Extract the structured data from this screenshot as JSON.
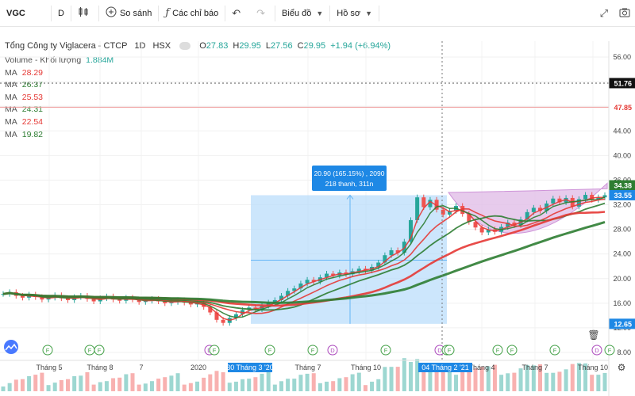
{
  "toolbar": {
    "symbol": "VGC",
    "interval": "D",
    "compare_label": "So sánh",
    "indicators_label": "Các chỉ báo",
    "chart_type_label": "Biểu đồ",
    "profile_label": "Hồ sơ"
  },
  "header": {
    "name": "Tổng Công ty Viglacera - CTCP",
    "interval": "1D",
    "exchange": "HSX",
    "o_label": "O",
    "o_value": "27.83",
    "h_label": "H",
    "h_value": "29.95",
    "l_label": "L",
    "l_value": "27.56",
    "c_label": "C",
    "c_value": "29.95",
    "change": "+1.94 (+6.94%)"
  },
  "volume": {
    "label": "Volume - Khối lượng",
    "value": "1.884M"
  },
  "ma_list": [
    {
      "label": "MA",
      "value": "28.29",
      "color": "#e53935"
    },
    {
      "label": "MA",
      "value": "26.37",
      "color": "#2e7d32"
    },
    {
      "label": "MA",
      "value": "25.53",
      "color": "#e53935"
    },
    {
      "label": "MA",
      "value": "24.31",
      "color": "#2e7d32"
    },
    {
      "label": "MA",
      "value": "22.54",
      "color": "#e53935"
    },
    {
      "label": "MA",
      "value": "19.82",
      "color": "#2e7d32"
    }
  ],
  "colors": {
    "up": "#26a69a",
    "down": "#ef5350",
    "ma_red": "#e53935",
    "ma_green": "#2e7d32",
    "measure_fill": "#bbdefb",
    "measure_label": "#1e88e5",
    "arc_fill": "#e1bee7"
  },
  "chart_data": {
    "type": "candlestick",
    "y_ticks": [
      "56.00",
      "52.00",
      "48.00",
      "44.00",
      "40.00",
      "36.00",
      "32.00",
      "28.00",
      "24.00",
      "20.00",
      "16.00",
      "12.00",
      "8.00"
    ],
    "ylim": [
      8,
      57
    ],
    "x_ticks": [
      "Tháng 5",
      "Tháng 8",
      "7",
      "2020",
      "Tháng 7",
      "Tháng 10",
      "Tháng 4",
      "Tháng 7",
      "Tháng 10"
    ],
    "x_highlight": [
      "30 Tháng 3 '20",
      "04 Tháng 2 '21"
    ],
    "price_labels": [
      {
        "value": "51.76",
        "style": "black"
      },
      {
        "value": "47.85",
        "style": "red"
      },
      {
        "value": "34.38",
        "style": "green"
      },
      {
        "value": "33.55",
        "style": "blue"
      },
      {
        "value": "12.65",
        "style": "blue"
      }
    ],
    "measure": {
      "line1": "20.90 (165.15%) , 2090",
      "line2": "218 thanh, 311n",
      "from": 12.65,
      "to": 33.55
    },
    "close_series": [
      17.5,
      17.8,
      17.2,
      16.9,
      17.4,
      17.0,
      16.6,
      16.9,
      17.3,
      16.8,
      16.5,
      17.0,
      17.2,
      16.7,
      16.3,
      16.8,
      17.1,
      16.6,
      16.4,
      16.9,
      16.6,
      16.2,
      16.4,
      16.7,
      16.3,
      16.0,
      16.2,
      16.5,
      16.1,
      15.8,
      16.0,
      15.4,
      14.5,
      13.3,
      12.8,
      13.6,
      14.2,
      14.9,
      15.3,
      15.0,
      15.6,
      16.1,
      16.5,
      17.2,
      18.0,
      18.4,
      19.2,
      19.8,
      19.5,
      20.2,
      20.8,
      20.5,
      21.0,
      20.7,
      21.2,
      21.6,
      21.3,
      21.9,
      22.6,
      23.8,
      24.6,
      24.2,
      26.0,
      29.5,
      33.2,
      31.6,
      32.8,
      31.2,
      30.4,
      31.0,
      31.8,
      30.5,
      29.2,
      28.3,
      27.5,
      28.0,
      27.6,
      28.4,
      29.1,
      28.7,
      29.6,
      30.8,
      31.5,
      31.0,
      32.2,
      33.0,
      32.4,
      33.1,
      31.7,
      32.9,
      33.6,
      32.8,
      33.2,
      33.55
    ],
    "annotation_markers": [
      "F",
      "F",
      "F",
      "D",
      "F",
      "F",
      "F",
      "D",
      "F",
      "D",
      "F",
      "F",
      "F",
      "F",
      "F",
      "D",
      "F"
    ]
  }
}
